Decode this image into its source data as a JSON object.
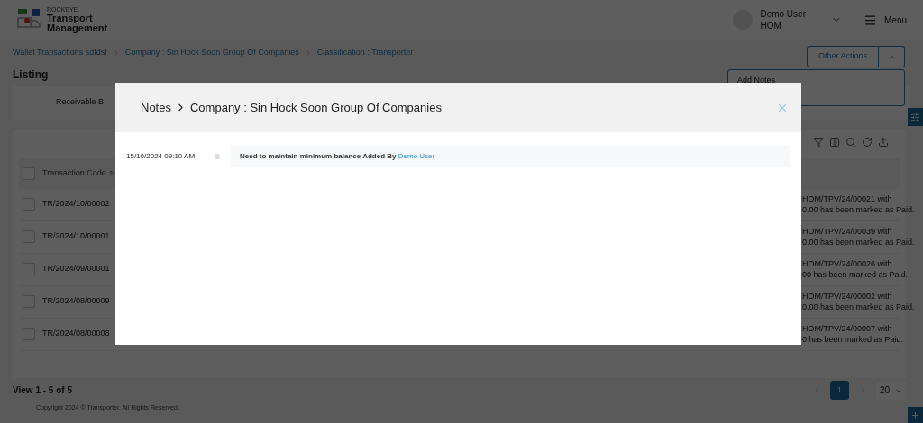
{
  "header": {
    "brand_small": "ROCKEYE",
    "brand_line_1": "Transport",
    "brand_line_2": "Management",
    "user_name": "Demo User",
    "user_role": "HOM",
    "menu_label": "Menu"
  },
  "breadcrumb": [
    "Wallet Transactions sdfdsf",
    "Company : Sin Hock Soon Group Of Companies",
    "Classification : Transporter"
  ],
  "page_title": "Listing",
  "other_actions": {
    "label": "Other Actions",
    "expanded": true,
    "items": [
      "Add Notes"
    ]
  },
  "summary": {
    "label": "Receivable B"
  },
  "table": {
    "all_checked": false,
    "columns": [
      {
        "label": "Transaction Code"
      }
    ],
    "rows": [
      {
        "code": "TR/2024/10/00002",
        "checked": false,
        "remark_line_1": "HOM/TPV/24/00021 with",
        "remark_line_2": "0.00 has been marked as Paid."
      },
      {
        "code": "TR/2024/10/00001",
        "checked": false,
        "remark_line_1": "HOM/TPV/24/00039 with",
        "remark_line_2": "0.00 has been marked as Paid."
      },
      {
        "code": "TR/2024/09/00001",
        "checked": false,
        "remark_line_1": "HOM/TPV/24/00026 with",
        "remark_line_2": "00 has been marked as Paid."
      },
      {
        "code": "TR/2024/08/00009",
        "checked": false,
        "remark_line_1": "HOM/TPV/24/00002 with",
        "remark_line_2": "0.00 has been marked as Paid."
      },
      {
        "code": "TR/2024/08/00008",
        "checked": false,
        "remark_line_1": "HOM/TPV/24/00007 with",
        "remark_line_2": "0 has been marked as Paid."
      }
    ]
  },
  "footer": {
    "view": "View 1 - 5 of 5",
    "pages": [
      {
        "label": "1",
        "selected": true
      }
    ],
    "page_size": "20"
  },
  "copyright": "Copyright 2024 © Transporter. All Rights Reserved.",
  "modal": {
    "title_1": "Notes",
    "title_2": "Company : Sin Hock Soon Group Of Companies",
    "notes": [
      {
        "time": "15/10/2024 09:10 AM",
        "text": "Need to maintain minimum balance Added By",
        "author": "Demo User"
      }
    ]
  }
}
